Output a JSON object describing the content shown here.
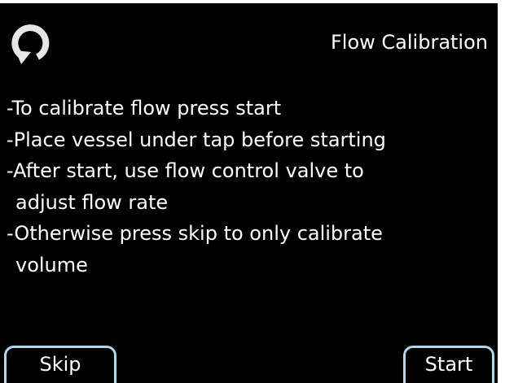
{
  "header": {
    "back_icon": "refresh-back-arrow-icon",
    "title": "Flow Calibration"
  },
  "instructions": {
    "lines": [
      "-To calibrate flow press start",
      "-Place vessel under tap before starting",
      "-After start, use flow control valve to",
      "adjust flow rate",
      "-Otherwise press skip to only calibrate",
      "volume"
    ]
  },
  "buttons": {
    "skip_label": "Skip",
    "start_label": "Start"
  },
  "colors": {
    "background": "#000000",
    "text": "#ffffff",
    "button_border": "#a8dcea"
  }
}
